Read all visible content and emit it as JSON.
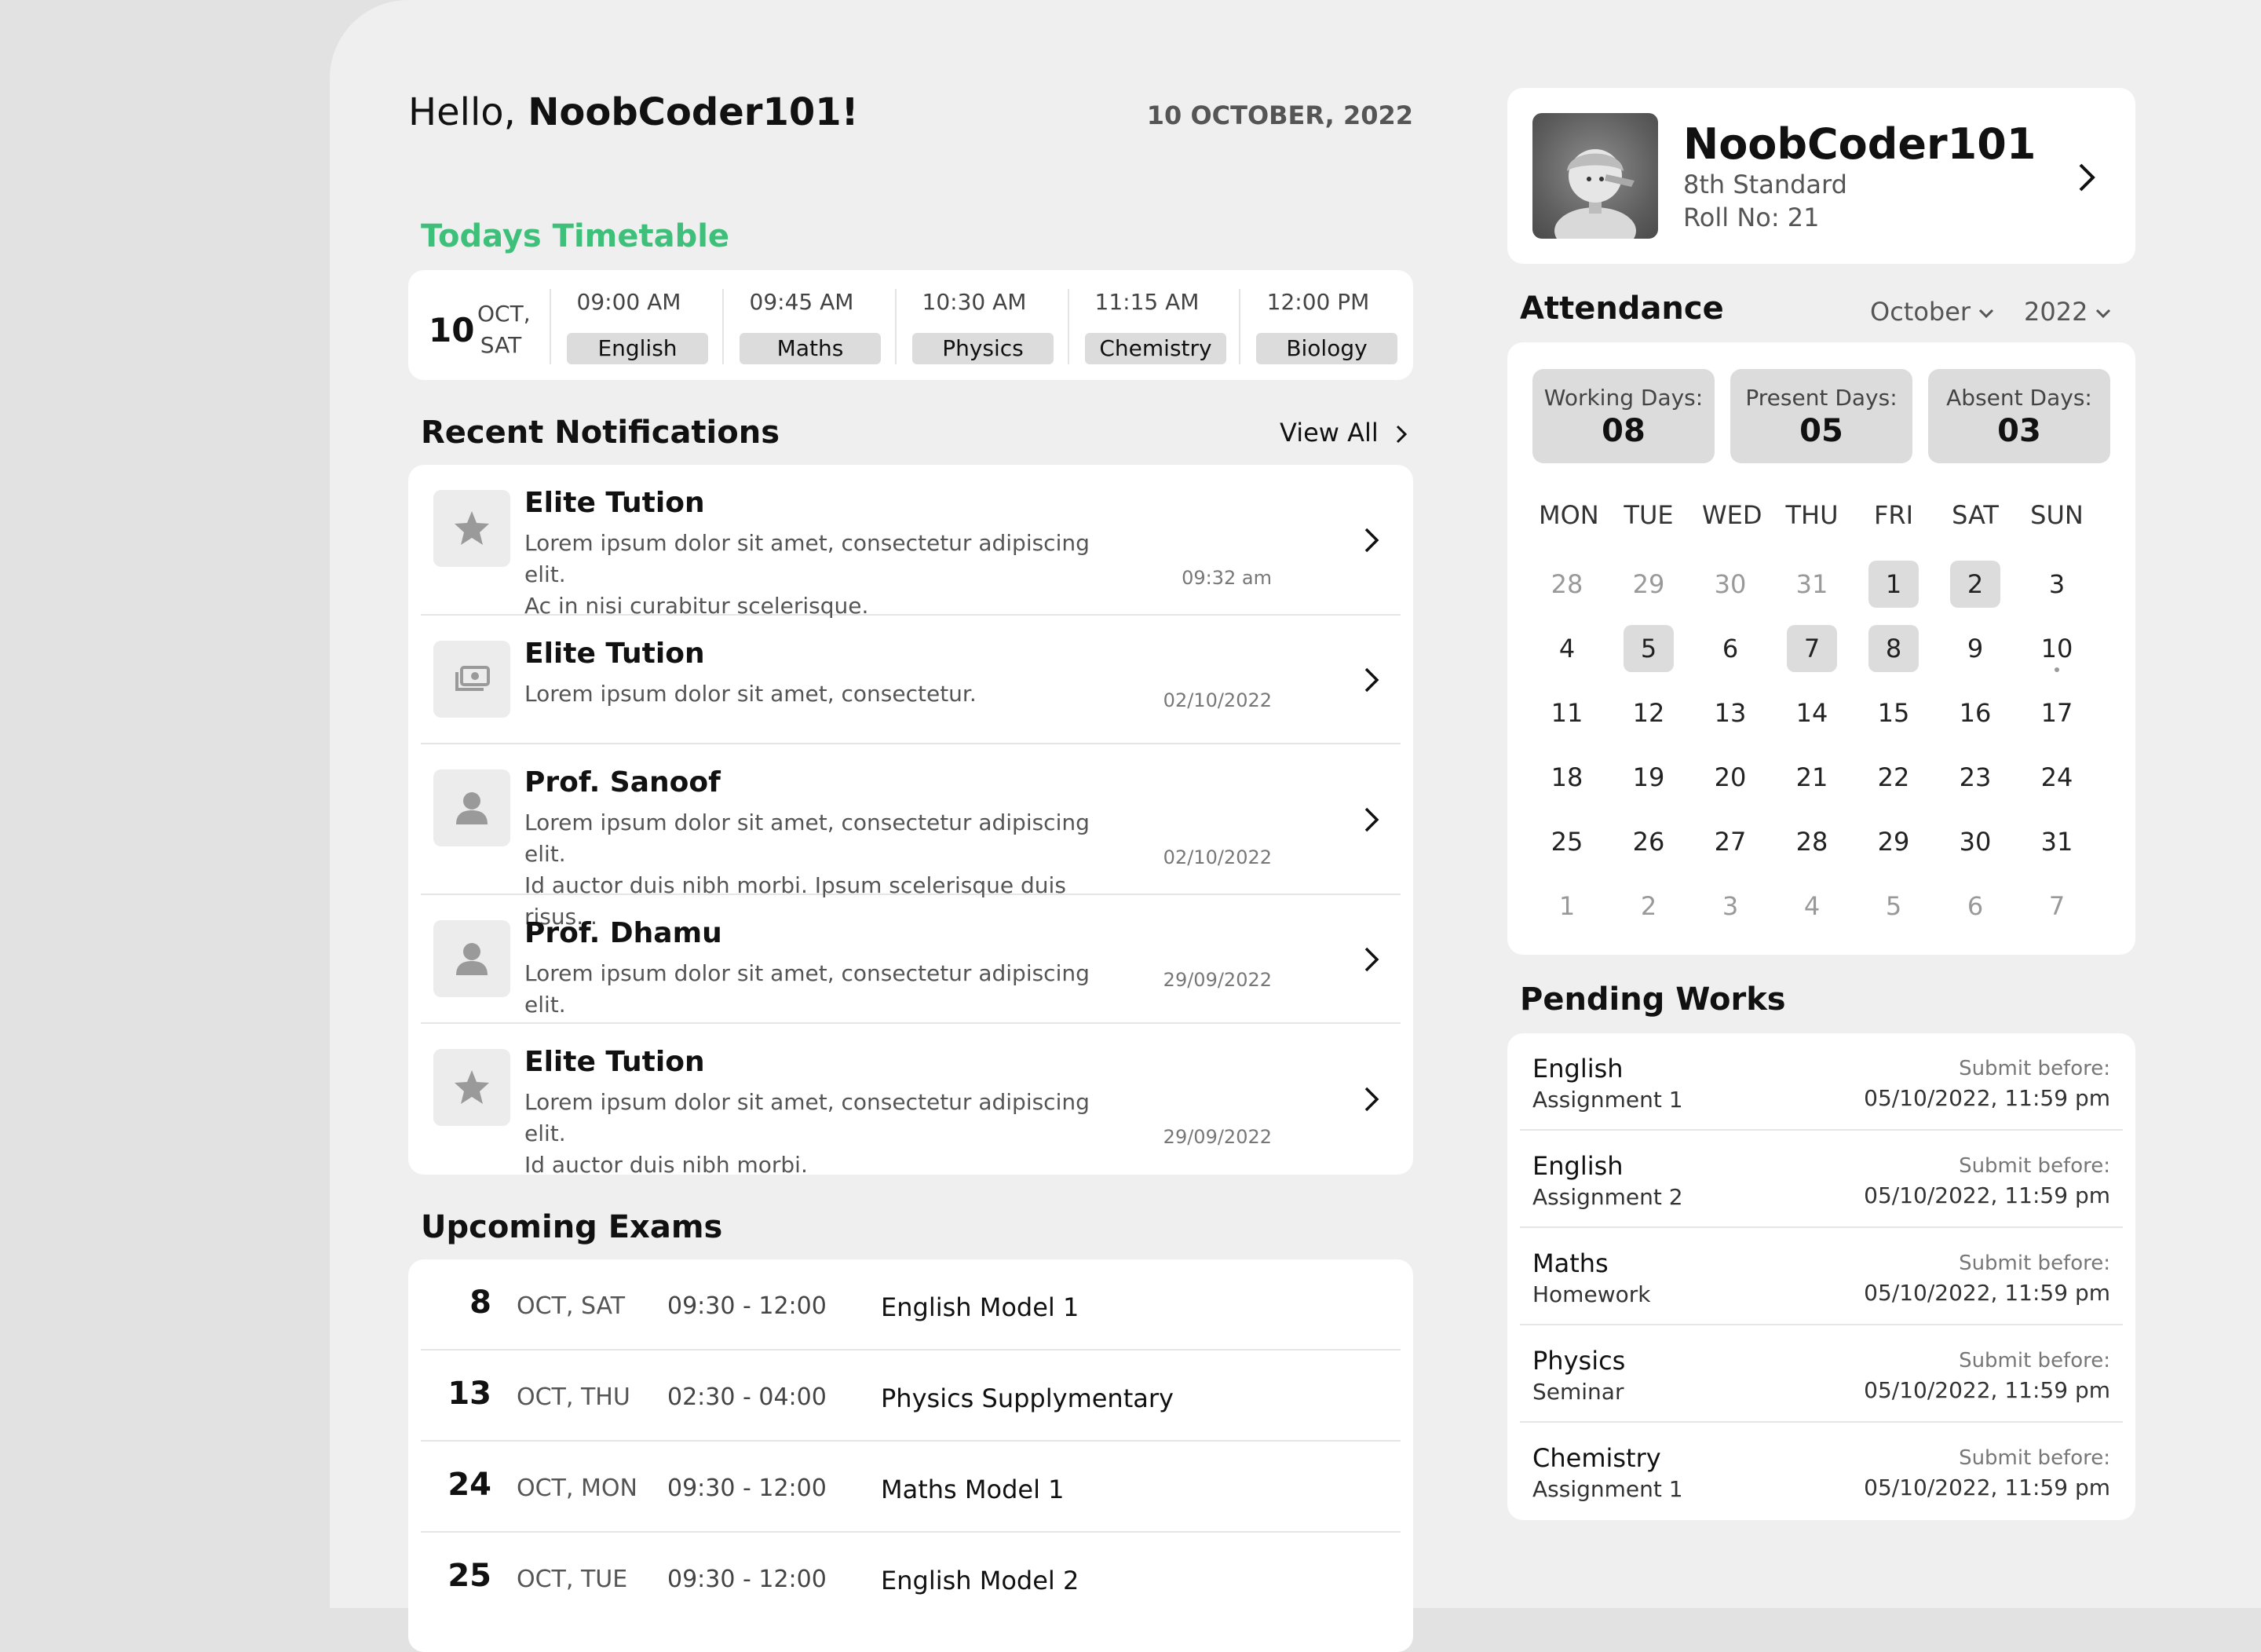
{
  "greeting": {
    "prefix": "Hello, ",
    "name": "NoobCoder101!"
  },
  "current_date": "10 OCTOBER, 2022",
  "timetable": {
    "title": "Todays Timetable",
    "day_num": "10",
    "day_month": "OCT,",
    "day_week": "SAT",
    "slots": [
      {
        "time": "09:00 AM",
        "subject": "English"
      },
      {
        "time": "09:45 AM",
        "subject": "Maths"
      },
      {
        "time": "10:30 AM",
        "subject": "Physics"
      },
      {
        "time": "11:15 AM",
        "subject": "Chemistry"
      },
      {
        "time": "12:00 PM",
        "subject": "Biology"
      }
    ]
  },
  "notifications": {
    "title": "Recent Notifications",
    "view_all": "View All",
    "items": [
      {
        "icon": "star-icon",
        "name": "Elite Tution",
        "line1": "Lorem ipsum dolor sit amet, consectetur adipiscing elit.",
        "line2": "Ac in nisi curabitur scelerisque.",
        "time": "09:32 am"
      },
      {
        "icon": "money-icon",
        "name": "Elite Tution",
        "line1": "Lorem ipsum dolor sit amet, consectetur.",
        "line2": "",
        "time": "02/10/2022"
      },
      {
        "icon": "person-icon",
        "name": "Prof. Sanoof",
        "line1": "Lorem ipsum dolor sit amet, consectetur adipiscing elit.",
        "line2": "Id auctor duis nibh morbi. Ipsum scelerisque duis risus...",
        "time": "02/10/2022"
      },
      {
        "icon": "person-icon",
        "name": "Prof. Dhamu",
        "line1": "Lorem ipsum dolor sit amet, consectetur adipiscing elit.",
        "line2": "",
        "time": "29/09/2022"
      },
      {
        "icon": "star-icon",
        "name": "Elite Tution",
        "line1": "Lorem ipsum dolor sit amet, consectetur adipiscing elit.",
        "line2": "Id auctor duis nibh morbi.",
        "time": "29/09/2022"
      }
    ]
  },
  "exams": {
    "title": "Upcoming Exams",
    "items": [
      {
        "day": "8",
        "weekday": "OCT, SAT",
        "time": "09:30 - 12:00",
        "name": "English Model 1"
      },
      {
        "day": "13",
        "weekday": "OCT, THU",
        "time": "02:30 - 04:00",
        "name": "Physics Supplymentary"
      },
      {
        "day": "24",
        "weekday": "OCT, MON",
        "time": "09:30 - 12:00",
        "name": "Maths Model 1"
      },
      {
        "day": "25",
        "weekday": "OCT, TUE",
        "time": "09:30 - 12:00",
        "name": "English Model 2"
      }
    ]
  },
  "profile": {
    "name": "NoobCoder101",
    "standard": "8th Standard",
    "roll": "Roll No: 21"
  },
  "attendance": {
    "title": "Attendance",
    "month": "October",
    "year": "2022",
    "stats": [
      {
        "label": "Working Days:",
        "value": "08"
      },
      {
        "label": "Present Days:",
        "value": "05"
      },
      {
        "label": "Absent Days:",
        "value": "03"
      }
    ],
    "weekdays": [
      "MON",
      "TUE",
      "WED",
      "THU",
      "FRI",
      "SAT",
      "SUN"
    ],
    "weeks": [
      [
        "28",
        "29",
        "30",
        "31",
        "1",
        "2",
        "3"
      ],
      [
        "4",
        "5",
        "6",
        "7",
        "8",
        "9",
        "10"
      ],
      [
        "11",
        "12",
        "13",
        "14",
        "15",
        "16",
        "17"
      ],
      [
        "18",
        "19",
        "20",
        "21",
        "22",
        "23",
        "24"
      ],
      [
        "25",
        "26",
        "27",
        "28",
        "29",
        "30",
        "31"
      ],
      [
        "1",
        "2",
        "3",
        "4",
        "5",
        "6",
        "7"
      ]
    ]
  },
  "pending": {
    "title": "Pending Works",
    "items": [
      {
        "subject": "English",
        "kind": "Assignment 1",
        "label": "Submit before:",
        "deadline": "05/10/2022, 11:59 pm"
      },
      {
        "subject": "English",
        "kind": "Assignment 2",
        "label": "Submit before:",
        "deadline": "05/10/2022, 11:59 pm"
      },
      {
        "subject": "Maths",
        "kind": "Homework",
        "label": "Submit before:",
        "deadline": "05/10/2022, 11:59 pm"
      },
      {
        "subject": "Physics",
        "kind": "Seminar",
        "label": "Submit before:",
        "deadline": "05/10/2022, 11:59 pm"
      },
      {
        "subject": "Chemistry",
        "kind": "Assignment 1",
        "label": "Submit before:",
        "deadline": "05/10/2022, 11:59 pm"
      }
    ]
  },
  "colors": {
    "accent_green": "#3fc07a",
    "chip": "#dcdcdc",
    "panel": "#efefef",
    "card": "#ffffff"
  }
}
